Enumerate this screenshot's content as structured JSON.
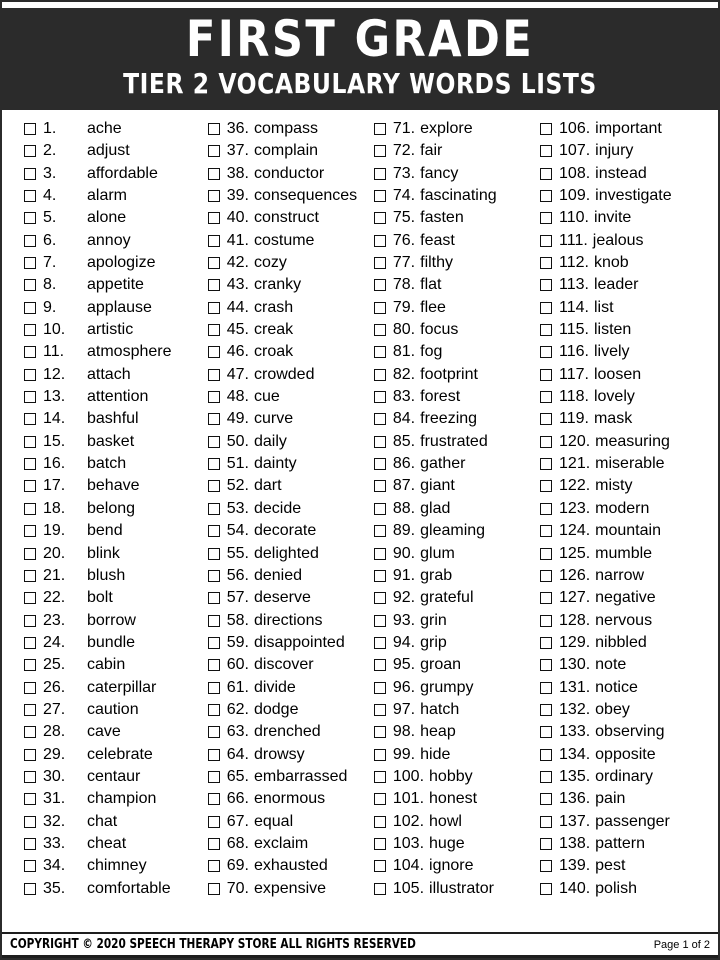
{
  "header": {
    "title": "FIRST GRADE",
    "subtitle": "TIER 2 VOCABULARY WORDS LISTS"
  },
  "footer": {
    "copyright": "COPYRIGHT © 2020 SPEECH THERAPY STORE ALL RIGHTS RESERVED",
    "page_number": "Page 1 of 2"
  },
  "colors": {
    "banner_background": "#2b2b2b",
    "banner_text": "#ffffff",
    "page_background": "#ffffff",
    "body_text": "#000000",
    "checkbox_border": "#111111"
  },
  "columns": [
    {
      "items": [
        {
          "number": "1.",
          "word": "ache",
          "checked": false
        },
        {
          "number": "2.",
          "word": "adjust",
          "checked": false
        },
        {
          "number": "3.",
          "word": "affordable",
          "checked": false
        },
        {
          "number": "4.",
          "word": "alarm",
          "checked": false
        },
        {
          "number": "5.",
          "word": "alone",
          "checked": false
        },
        {
          "number": "6.",
          "word": "annoy",
          "checked": false
        },
        {
          "number": "7.",
          "word": "apologize",
          "checked": false
        },
        {
          "number": "8.",
          "word": "appetite",
          "checked": false
        },
        {
          "number": "9.",
          "word": "applause",
          "checked": false
        },
        {
          "number": "10.",
          "word": "artistic",
          "checked": false
        },
        {
          "number": "11.",
          "word": "atmosphere",
          "checked": false
        },
        {
          "number": "12.",
          "word": "attach",
          "checked": false
        },
        {
          "number": "13.",
          "word": "attention",
          "checked": false
        },
        {
          "number": "14.",
          "word": "bashful",
          "checked": false
        },
        {
          "number": "15.",
          "word": "basket",
          "checked": false
        },
        {
          "number": "16.",
          "word": "batch",
          "checked": false
        },
        {
          "number": "17.",
          "word": "behave",
          "checked": false
        },
        {
          "number": "18.",
          "word": "belong",
          "checked": false
        },
        {
          "number": "19.",
          "word": "bend",
          "checked": false
        },
        {
          "number": "20.",
          "word": "blink",
          "checked": false
        },
        {
          "number": "21.",
          "word": "blush",
          "checked": false
        },
        {
          "number": "22.",
          "word": "bolt",
          "checked": false
        },
        {
          "number": "23.",
          "word": "borrow",
          "checked": false
        },
        {
          "number": "24.",
          "word": "bundle",
          "checked": false
        },
        {
          "number": "25.",
          "word": "cabin",
          "checked": false
        },
        {
          "number": "26.",
          "word": "caterpillar",
          "checked": false
        },
        {
          "number": "27.",
          "word": "caution",
          "checked": false
        },
        {
          "number": "28.",
          "word": "cave",
          "checked": false
        },
        {
          "number": "29.",
          "word": "celebrate",
          "checked": false
        },
        {
          "number": "30.",
          "word": "centaur",
          "checked": false
        },
        {
          "number": "31.",
          "word": "champion",
          "checked": false
        },
        {
          "number": "32.",
          "word": "chat",
          "checked": false
        },
        {
          "number": "33.",
          "word": "cheat",
          "checked": false
        },
        {
          "number": "34.",
          "word": "chimney",
          "checked": false
        },
        {
          "number": "35.",
          "word": "comfortable",
          "checked": false
        }
      ]
    },
    {
      "items": [
        {
          "number": "36.",
          "word": "compass",
          "checked": false
        },
        {
          "number": "37.",
          "word": "complain",
          "checked": false
        },
        {
          "number": "38.",
          "word": "conductor",
          "checked": false
        },
        {
          "number": "39.",
          "word": "consequences",
          "checked": false
        },
        {
          "number": "40.",
          "word": "construct",
          "checked": false
        },
        {
          "number": "41.",
          "word": "costume",
          "checked": false
        },
        {
          "number": "42.",
          "word": "cozy",
          "checked": false
        },
        {
          "number": "43.",
          "word": "cranky",
          "checked": false
        },
        {
          "number": "44.",
          "word": "crash",
          "checked": false
        },
        {
          "number": "45.",
          "word": "creak",
          "checked": false
        },
        {
          "number": "46.",
          "word": "croak",
          "checked": false
        },
        {
          "number": "47.",
          "word": "crowded",
          "checked": false
        },
        {
          "number": "48.",
          "word": "cue",
          "checked": false
        },
        {
          "number": "49.",
          "word": "curve",
          "checked": false
        },
        {
          "number": "50.",
          "word": "daily",
          "checked": false
        },
        {
          "number": "51.",
          "word": "dainty",
          "checked": false
        },
        {
          "number": "52.",
          "word": "dart",
          "checked": false
        },
        {
          "number": "53.",
          "word": "decide",
          "checked": false
        },
        {
          "number": "54.",
          "word": "decorate",
          "checked": false
        },
        {
          "number": "55.",
          "word": "delighted",
          "checked": false
        },
        {
          "number": "56.",
          "word": "denied",
          "checked": false
        },
        {
          "number": "57.",
          "word": "deserve",
          "checked": false
        },
        {
          "number": "58.",
          "word": "directions",
          "checked": false
        },
        {
          "number": "59.",
          "word": "disappointed",
          "checked": false
        },
        {
          "number": "60.",
          "word": "discover",
          "checked": false
        },
        {
          "number": "61.",
          "word": "divide",
          "checked": false
        },
        {
          "number": "62.",
          "word": "dodge",
          "checked": false
        },
        {
          "number": "63.",
          "word": "drenched",
          "checked": false
        },
        {
          "number": "64.",
          "word": "drowsy",
          "checked": false
        },
        {
          "number": "65.",
          "word": "embarrassed",
          "checked": false
        },
        {
          "number": "66.",
          "word": "enormous",
          "checked": false
        },
        {
          "number": "67.",
          "word": "equal",
          "checked": false
        },
        {
          "number": "68.",
          "word": "exclaim",
          "checked": false
        },
        {
          "number": "69.",
          "word": "exhausted",
          "checked": false
        },
        {
          "number": "70.",
          "word": "expensive",
          "checked": false
        }
      ]
    },
    {
      "items": [
        {
          "number": "71.",
          "word": "explore",
          "checked": false
        },
        {
          "number": "72.",
          "word": "fair",
          "checked": false
        },
        {
          "number": "73.",
          "word": "fancy",
          "checked": false
        },
        {
          "number": "74.",
          "word": "fascinating",
          "checked": false
        },
        {
          "number": "75.",
          "word": "fasten",
          "checked": false
        },
        {
          "number": "76.",
          "word": "feast",
          "checked": false
        },
        {
          "number": "77.",
          "word": "filthy",
          "checked": false
        },
        {
          "number": "78.",
          "word": "flat",
          "checked": false
        },
        {
          "number": "79.",
          "word": "flee",
          "checked": false
        },
        {
          "number": "80.",
          "word": "focus",
          "checked": false
        },
        {
          "number": "81.",
          "word": "fog",
          "checked": false
        },
        {
          "number": "82.",
          "word": "footprint",
          "checked": false
        },
        {
          "number": "83.",
          "word": "forest",
          "checked": false
        },
        {
          "number": "84.",
          "word": "freezing",
          "checked": false
        },
        {
          "number": "85.",
          "word": "frustrated",
          "checked": false
        },
        {
          "number": "86.",
          "word": "gather",
          "checked": false
        },
        {
          "number": "87.",
          "word": "giant",
          "checked": false
        },
        {
          "number": "88.",
          "word": "glad",
          "checked": false
        },
        {
          "number": "89.",
          "word": "gleaming",
          "checked": false
        },
        {
          "number": "90.",
          "word": "glum",
          "checked": false
        },
        {
          "number": "91.",
          "word": "grab",
          "checked": false
        },
        {
          "number": "92.",
          "word": "grateful",
          "checked": false
        },
        {
          "number": "93.",
          "word": "grin",
          "checked": false
        },
        {
          "number": "94.",
          "word": "grip",
          "checked": false
        },
        {
          "number": "95.",
          "word": "groan",
          "checked": false
        },
        {
          "number": "96.",
          "word": "grumpy",
          "checked": false
        },
        {
          "number": "97.",
          "word": "hatch",
          "checked": false
        },
        {
          "number": "98.",
          "word": "heap",
          "checked": false
        },
        {
          "number": "99.",
          "word": "hide",
          "checked": false
        },
        {
          "number": "100.",
          "word": "hobby",
          "checked": false
        },
        {
          "number": "101.",
          "word": "honest",
          "checked": false
        },
        {
          "number": "102.",
          "word": "howl",
          "checked": false
        },
        {
          "number": "103.",
          "word": "huge",
          "checked": false
        },
        {
          "number": "104.",
          "word": "ignore",
          "checked": false
        },
        {
          "number": "105.",
          "word": "illustrator",
          "checked": false
        }
      ]
    },
    {
      "items": [
        {
          "number": "106.",
          "word": "important",
          "checked": false
        },
        {
          "number": "107.",
          "word": "injury",
          "checked": false
        },
        {
          "number": "108.",
          "word": "instead",
          "checked": false
        },
        {
          "number": "109.",
          "word": "investigate",
          "checked": false
        },
        {
          "number": "110.",
          "word": "invite",
          "checked": false
        },
        {
          "number": "111.",
          "word": "jealous",
          "checked": false
        },
        {
          "number": "112.",
          "word": "knob",
          "checked": false
        },
        {
          "number": "113.",
          "word": "leader",
          "checked": false
        },
        {
          "number": "114.",
          "word": "list",
          "checked": false
        },
        {
          "number": "115.",
          "word": "listen",
          "checked": false
        },
        {
          "number": "116.",
          "word": "lively",
          "checked": false
        },
        {
          "number": "117.",
          "word": "loosen",
          "checked": false
        },
        {
          "number": "118.",
          "word": "lovely",
          "checked": false
        },
        {
          "number": "119.",
          "word": "mask",
          "checked": false
        },
        {
          "number": "120.",
          "word": "measuring",
          "checked": false
        },
        {
          "number": "121.",
          "word": "miserable",
          "checked": false
        },
        {
          "number": "122.",
          "word": "misty",
          "checked": false
        },
        {
          "number": "123.",
          "word": "modern",
          "checked": false
        },
        {
          "number": "124.",
          "word": "mountain",
          "checked": false
        },
        {
          "number": "125.",
          "word": "mumble",
          "checked": false
        },
        {
          "number": "126.",
          "word": "narrow",
          "checked": false
        },
        {
          "number": "127.",
          "word": "negative",
          "checked": false
        },
        {
          "number": "128.",
          "word": "nervous",
          "checked": false
        },
        {
          "number": "129.",
          "word": "nibbled",
          "checked": false
        },
        {
          "number": "130.",
          "word": "note",
          "checked": false
        },
        {
          "number": "131.",
          "word": "notice",
          "checked": false
        },
        {
          "number": "132.",
          "word": "obey",
          "checked": false
        },
        {
          "number": "133.",
          "word": "observing",
          "checked": false
        },
        {
          "number": "134.",
          "word": "opposite",
          "checked": false
        },
        {
          "number": "135.",
          "word": "ordinary",
          "checked": false
        },
        {
          "number": "136.",
          "word": "pain",
          "checked": false
        },
        {
          "number": "137.",
          "word": "passenger",
          "checked": false
        },
        {
          "number": "138.",
          "word": "pattern",
          "checked": false
        },
        {
          "number": "139.",
          "word": "pest",
          "checked": false
        },
        {
          "number": "140.",
          "word": "polish",
          "checked": false
        }
      ]
    }
  ]
}
